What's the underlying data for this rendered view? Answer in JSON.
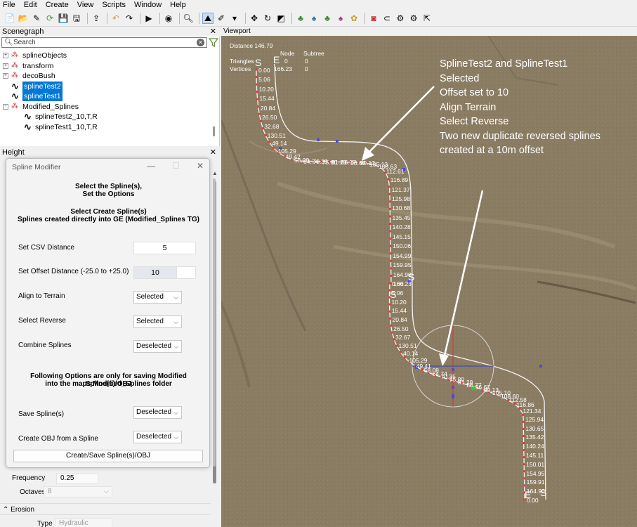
{
  "menu": [
    "File",
    "Edit",
    "Create",
    "View",
    "Scripts",
    "Window",
    "Help"
  ],
  "toolbar_icons": [
    "new-file-icon",
    "open-folder-icon",
    "edit-icon",
    "refresh-icon",
    "save-icon",
    "save-as-icon",
    "sep",
    "share-icon",
    "sep",
    "undo-icon",
    "redo-icon",
    "sep",
    "play-icon",
    "sep",
    "eye-icon",
    "sep",
    "search-icon",
    "sep",
    "terrain-icon",
    "brush-icon",
    "dropdown-icon",
    "sep",
    "move-icon",
    "rotate-icon",
    "scale-icon",
    "sep",
    "tree-tool-1-icon",
    "tree-tool-2-icon",
    "tree-tool-3-icon",
    "tree-tool-4-icon",
    "plant-icon",
    "sep",
    "material-icon",
    "link-icon",
    "gear-multi-icon",
    "settings-icon",
    "export-icon"
  ],
  "scenegraph": {
    "title": "Scenegraph",
    "search_placeholder": "Search",
    "nodes": [
      {
        "label": "splineObjects",
        "type": "group",
        "level": 0,
        "expander": "+",
        "selected": false
      },
      {
        "label": "transform",
        "type": "group",
        "level": 0,
        "expander": "+",
        "selected": false
      },
      {
        "label": "decoBush",
        "type": "group",
        "level": 0,
        "expander": "+",
        "selected": false
      },
      {
        "label": "splineTest2",
        "type": "spline",
        "level": 0,
        "expander": "",
        "selected": true
      },
      {
        "label": "splineTest1",
        "type": "spline",
        "level": 0,
        "expander": "",
        "selected": true
      },
      {
        "label": "Modified_Splines",
        "type": "group",
        "level": 0,
        "expander": "-",
        "selected": false
      },
      {
        "label": "splineTest2_10,T,R",
        "type": "spline",
        "level": 1,
        "expander": "",
        "selected": false
      },
      {
        "label": "splineTest1_10,T,R",
        "type": "spline",
        "level": 1,
        "expander": "",
        "selected": false
      }
    ]
  },
  "height_panel": {
    "title": "Height"
  },
  "dialog": {
    "title": "Spline Modifier",
    "line1": "Select the Spline(s),",
    "line2": "Set the Options",
    "line3": "Select Create Spline(s)",
    "line4": "Splines created directly into GE (Modified_Splines TG)",
    "csv_label": "Set CSV Distance",
    "csv_value": "5",
    "offset_label": "Set Offset Distance (-25.0 to +25.0)",
    "offset_value": "10",
    "align_label": "Align to Terrain",
    "align_value": "Selected",
    "reverse_label": "Select Reverse",
    "reverse_value": "Selected",
    "combine_label": "Combine Splines",
    "combine_value": "Deselected",
    "note1": "Following Options are only for saving Modified Spline(s)/OBJ",
    "note2": "into the maps Modified_Splines folder",
    "save_label": "Save Spline(s)",
    "save_value": "Deselected",
    "obj_label": "Create OBJ from a Spline",
    "obj_value": "Deselected",
    "button": "Create/Save Spline(s)/OBJ"
  },
  "properties": {
    "frequency_label": "Frequency",
    "frequency_value": "0.25",
    "octaves_label": "Octaves",
    "octaves_value": "8",
    "erosion_label": "Erosion",
    "type_label": "Type",
    "type_value": "Hydraulic"
  },
  "viewport": {
    "title": "Viewport",
    "distance": "Distance 146.79",
    "col_node": "Node",
    "col_subtree": "Subtree",
    "row_triangles": "Triangles",
    "row_vertices": "Vertices",
    "tri_node": "0",
    "tri_subtree": "0",
    "vert_node": "166.23",
    "vert_subtree": "0",
    "annotation": [
      "SplineTest2 and SplineTest1",
      "Selected",
      "Offset set to 10",
      "Align Terrain",
      "Select Reverse",
      "Two new duplicate reversed splines",
      "created at a 10m offset"
    ],
    "top_labels": [
      "0.00",
      "5.06",
      "10.20",
      "15.44",
      "20.84",
      "26.50",
      "32.68",
      "130.51",
      "49.14",
      "105.29",
      "49.42",
      "58.08",
      "64.74",
      "70.35",
      "75.80",
      "81.28",
      "86.77",
      "96.67",
      "99.13",
      "105.13",
      "108.63",
      "112.61",
      "116.89",
      "121.37",
      "125.98",
      "130.68",
      "135.45",
      "140.28",
      "145.15",
      "150.06",
      "154.99",
      "159.95",
      "164.90",
      "166.23"
    ],
    "bottom_labels": [
      "0.00",
      "5.06",
      "10.20",
      "15.44",
      "20.84",
      "26.50",
      "32.67",
      "130.51",
      "40.14",
      "105.29",
      "49.41",
      "58.08",
      "64.74",
      "70.35",
      "75.80",
      "81.28",
      "86.77",
      "96.67",
      "99.13",
      "105.10",
      "108.60",
      "112.58",
      "116.86",
      "121.34",
      "125.94",
      "130.65",
      "135.42",
      "140.24",
      "145.11",
      "150.01",
      "154.95",
      "159.91",
      "164.90",
      "0.00"
    ]
  },
  "colors": {
    "terrain": "#8a7c63",
    "terrain_light": "#a19479",
    "spline": "#f4f4f4",
    "point": "#e23a3a",
    "selection": "#0078d7",
    "control_point": "#4a4ad8"
  }
}
